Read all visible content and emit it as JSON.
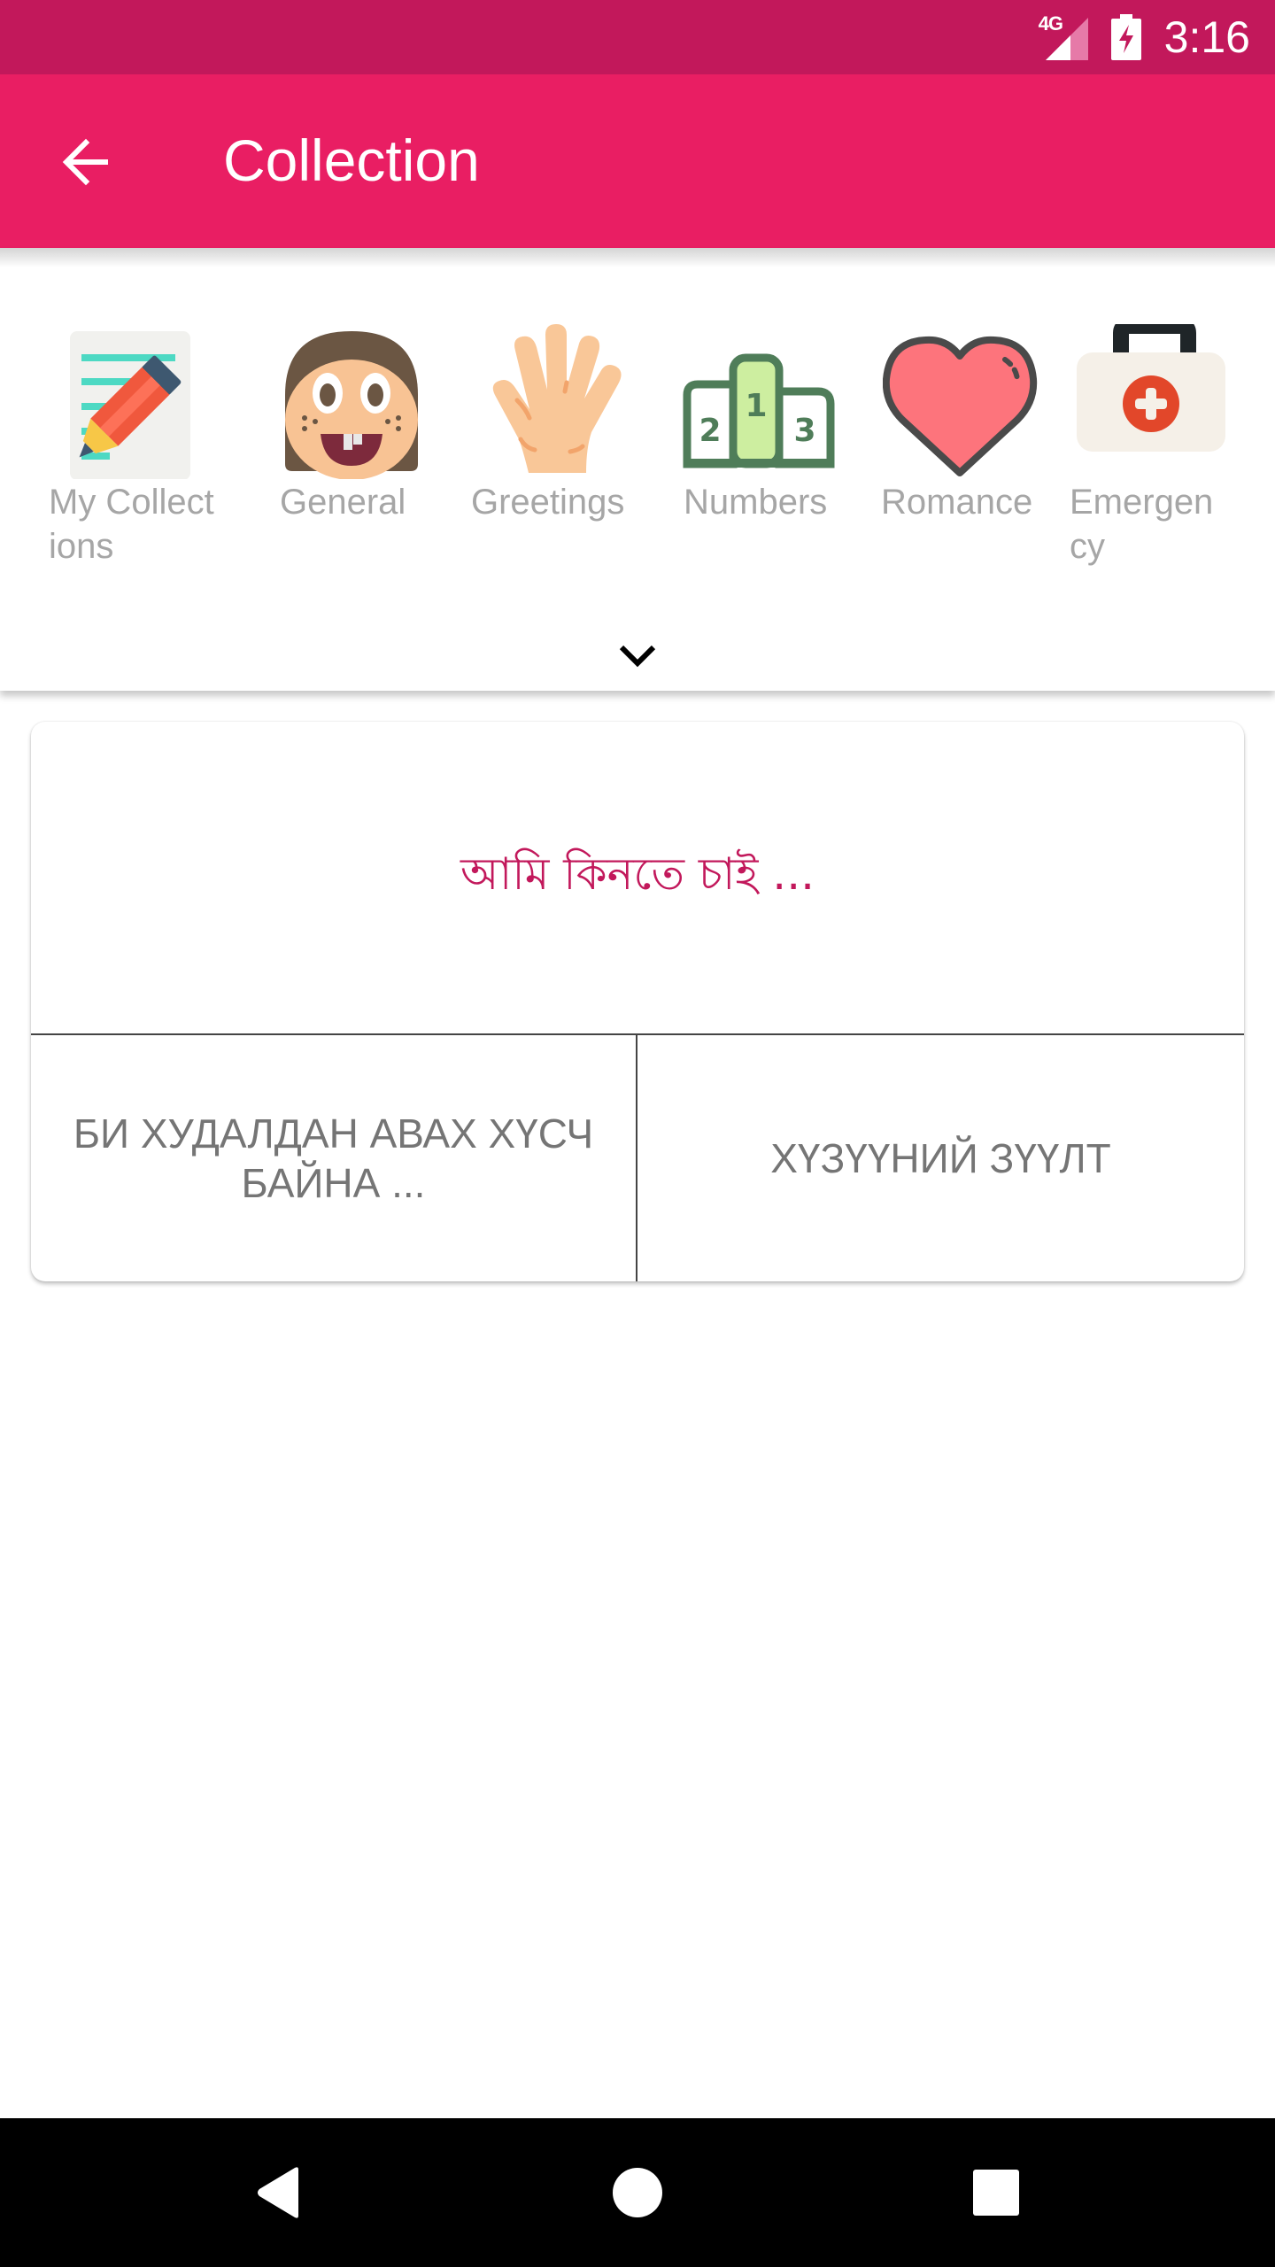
{
  "status_bar": {
    "network_label": "4G",
    "time": "3:16",
    "icons": [
      "network-4g-icon",
      "signal-icon",
      "battery-charging-icon"
    ],
    "background_color": "#C2185B"
  },
  "app_bar": {
    "title": "Collection",
    "back_icon": "arrow-back-icon",
    "background_color": "#E91E63"
  },
  "categories": {
    "items": [
      {
        "label": "My Collect\nions",
        "icon": "notepad-pencil-icon"
      },
      {
        "label": "General",
        "icon": "smiling-face-icon"
      },
      {
        "label": "Greetings",
        "icon": "waving-hand-icon"
      },
      {
        "label": "Numbers",
        "icon": "podium-icon"
      },
      {
        "label": "Romance",
        "icon": "heart-icon"
      },
      {
        "label": "Emergen\ncy",
        "icon": "first-aid-kit-icon"
      }
    ],
    "expand_icon": "chevron-down-icon"
  },
  "phrase_card": {
    "source_text": "আমি কিনতে চাই ...",
    "translation_text": "БИ ХУДАЛДАН АВАХ ХҮСЧ БАЙНА ...",
    "transliteration_text": "ХҮЗҮҮНИЙ ЗҮҮЛТ",
    "accent_color": "#C2185B"
  },
  "nav_bar": {
    "back_icon": "nav-back-icon",
    "home_icon": "nav-home-icon",
    "recents_icon": "nav-recents-icon"
  }
}
